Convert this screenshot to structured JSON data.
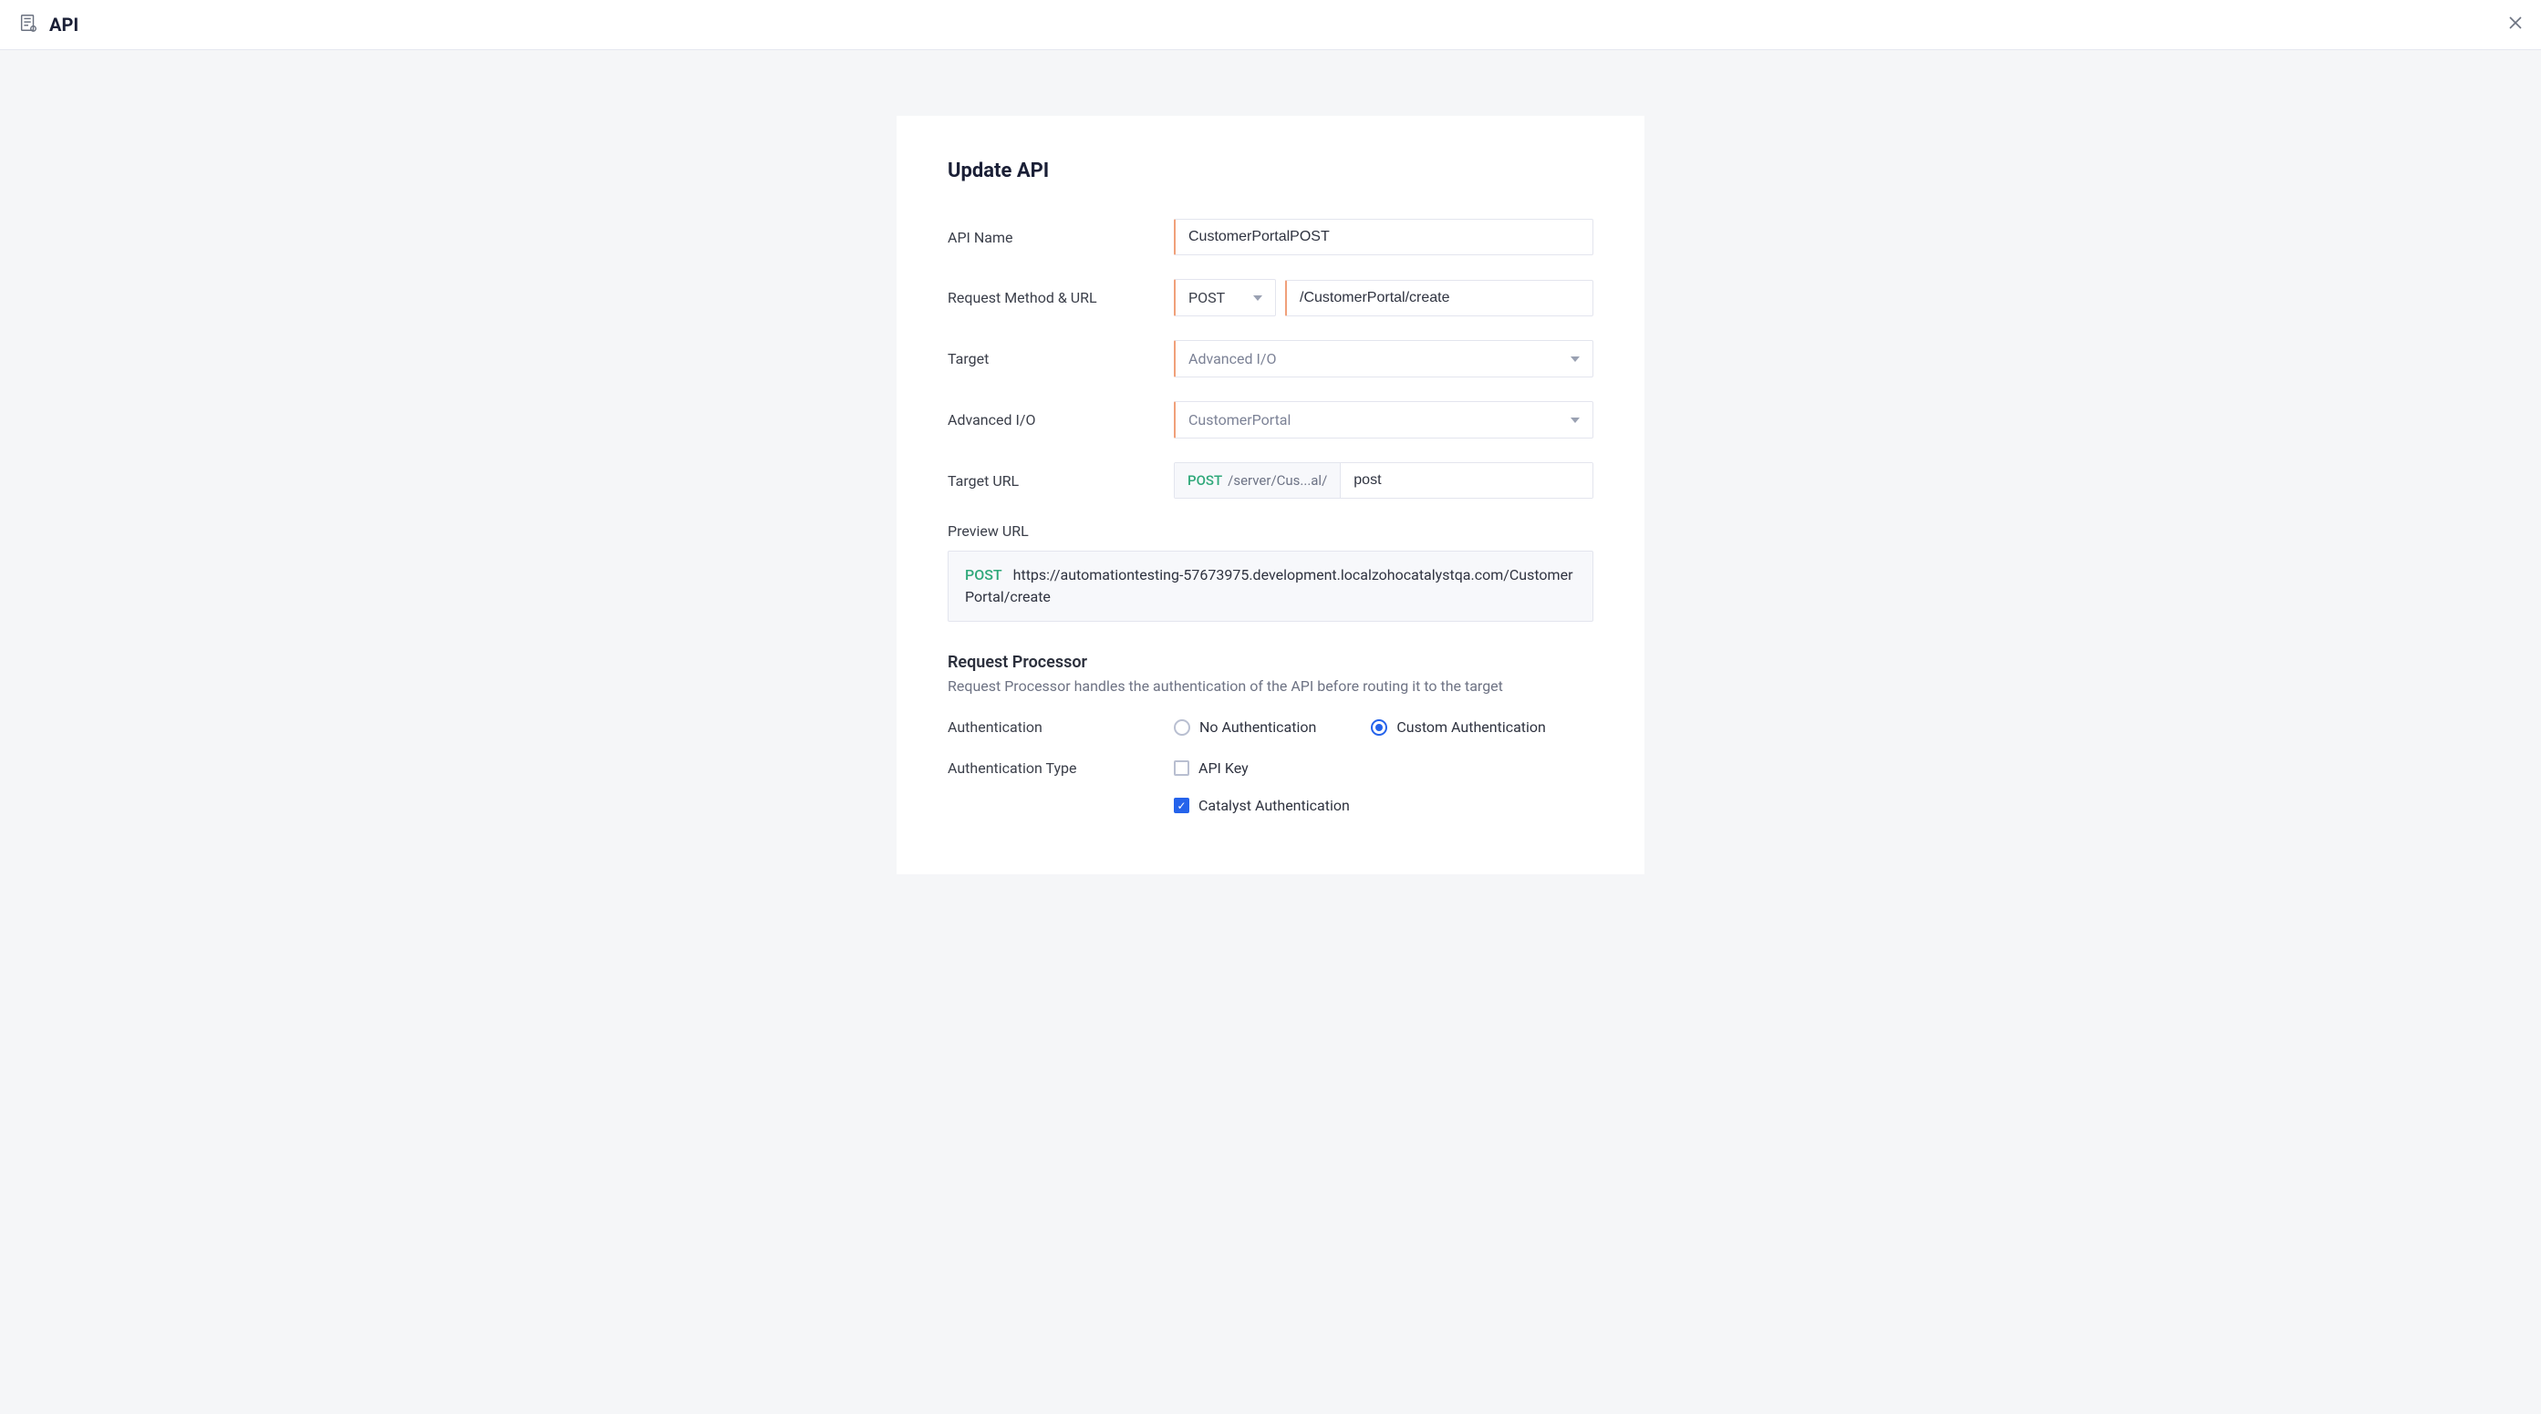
{
  "header": {
    "title": "API"
  },
  "panel": {
    "heading": "Update API"
  },
  "form": {
    "api_name_label": "API Name",
    "api_name_value": "CustomerPortalPOST",
    "request_method_label": "Request Method & URL",
    "request_method_value": "POST",
    "request_url_value": "/CustomerPortal/create",
    "target_label": "Target",
    "target_value": "Advanced I/O",
    "advanced_io_label": "Advanced I/O",
    "advanced_io_value": "CustomerPortal",
    "target_url_label": "Target URL",
    "target_url_method": "POST",
    "target_url_prefix": "/server/Cus...al/",
    "target_url_value": "post",
    "preview_url_label": "Preview URL",
    "preview_url_method": "POST",
    "preview_url_value": "https://automationtesting-57673975.development.localzohocatalystqa.com/CustomerPortal/create",
    "request_processor_title": "Request Processor",
    "request_processor_desc": "Request Processor handles the authentication of the API before routing it to the target",
    "authentication_label": "Authentication",
    "auth_options": {
      "none": "No Authentication",
      "custom": "Custom Authentication"
    },
    "auth_type_label": "Authentication Type",
    "auth_types": {
      "api_key": "API Key",
      "catalyst": "Catalyst Authentication"
    }
  }
}
